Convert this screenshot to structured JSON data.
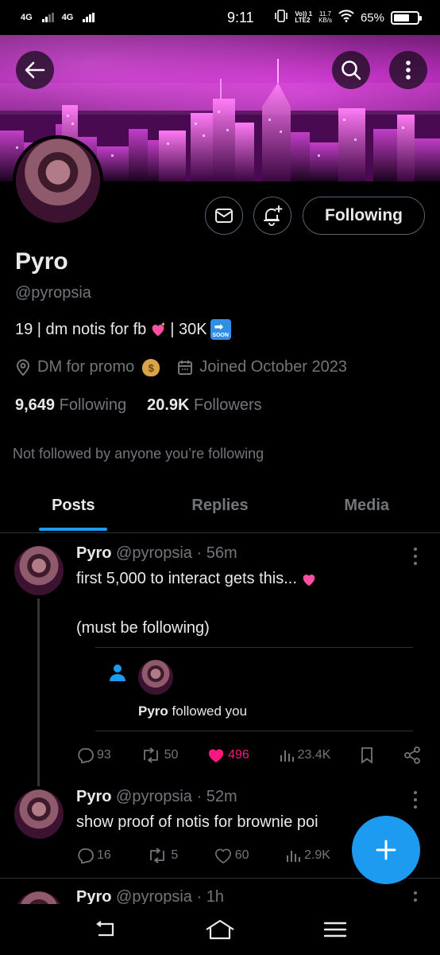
{
  "status_bar": {
    "net1": "4G",
    "net2": "4G",
    "time": "9:11",
    "volte": "Vo)) 1\nLTE2",
    "speed": "11.7\nKB/s",
    "battery": "65%"
  },
  "profile": {
    "display_name": "Pyro",
    "handle": "@pyropsia",
    "bio_part1": "19 | dm notis for fb",
    "bio_part2": "| 30K",
    "soon_badge": "SOON",
    "location": "DM for promo",
    "joined": "Joined October 2023",
    "following_count": "9,649",
    "following_label": "Following",
    "followers_count": "20.9K",
    "followers_label": "Followers",
    "not_followed": "Not followed by anyone you’re following",
    "follow_button": "Following"
  },
  "tabs": [
    {
      "label": "Posts",
      "active": true
    },
    {
      "label": "Replies",
      "active": false
    },
    {
      "label": "Media",
      "active": false
    }
  ],
  "posts": [
    {
      "name": "Pyro",
      "meta": "@pyropsia · 56m",
      "text_line1": "first 5,000 to interact gets this...",
      "text_line2": "(must be following)",
      "quote_name": "Pyro",
      "quote_text": "followed you",
      "replies": "93",
      "reposts": "50",
      "likes": "496",
      "views": "23.4K"
    },
    {
      "name": "Pyro",
      "meta": "@pyropsia · 52m",
      "text_line1": "show proof of notis for brownie poi",
      "replies": "16",
      "reposts": "5",
      "likes": "60",
      "views": "2.9K"
    },
    {
      "name": "Pyro",
      "meta": "@pyropsia · 1h"
    }
  ],
  "colors": {
    "accent": "#1d9bf0",
    "like": "#f91880",
    "muted": "#71767b",
    "text": "#e7e9ea",
    "background": "#000000"
  }
}
